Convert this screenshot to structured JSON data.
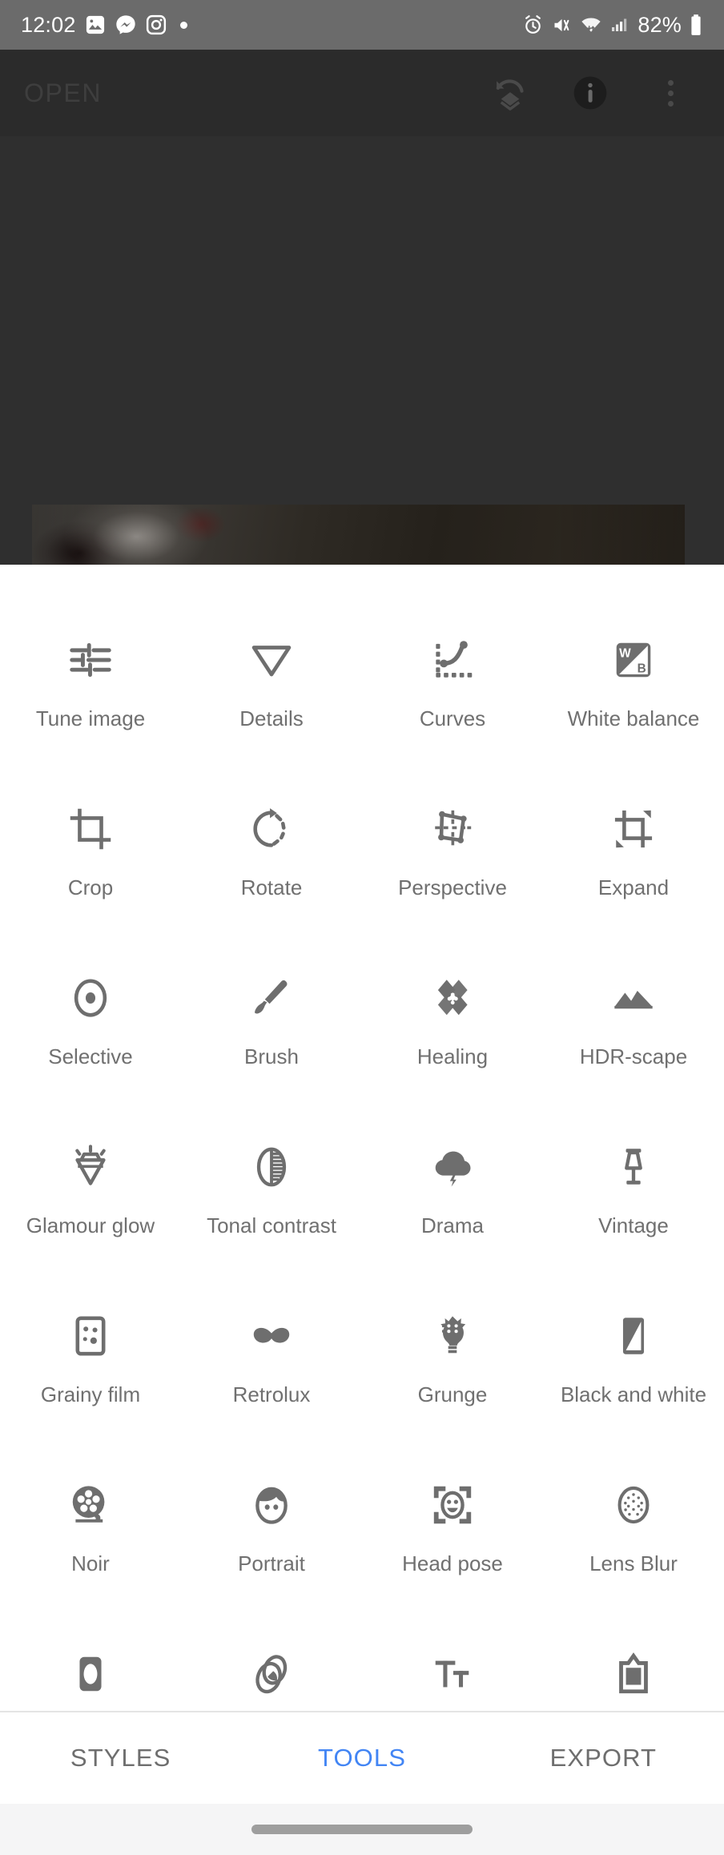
{
  "status_bar": {
    "time": "12:02",
    "battery_percent": "82%",
    "left_icons": [
      "photos-icon",
      "messenger-icon",
      "instagram-icon",
      "dot-indicator-icon"
    ],
    "right_icons": [
      "alarm-icon",
      "vibrate-mute-icon",
      "wifi-icon",
      "cellular-signal-icon",
      "battery-icon"
    ],
    "background_color": "#6b6b6b",
    "foreground_color": "#ffffff"
  },
  "app_bar": {
    "title": "OPEN",
    "background_color": "#2b2b2b",
    "actions": [
      {
        "name": "undo-stack-icon",
        "label": "Undo / Stacks"
      },
      {
        "name": "info-icon",
        "label": "Info"
      },
      {
        "name": "overflow-menu-icon",
        "label": "More options"
      }
    ]
  },
  "canvas": {
    "background_color": "#2f2f2f",
    "photo_description": "dark low-key photo of a rose and dark background"
  },
  "tools": {
    "rows": [
      [
        {
          "label": "Tune image",
          "icon": "sliders-icon"
        },
        {
          "label": "Details",
          "icon": "triangle-down-icon"
        },
        {
          "label": "Curves",
          "icon": "curves-icon"
        },
        {
          "label": "White balance",
          "icon": "white-balance-icon"
        }
      ],
      [
        {
          "label": "Crop",
          "icon": "crop-icon"
        },
        {
          "label": "Rotate",
          "icon": "rotate-icon"
        },
        {
          "label": "Perspective",
          "icon": "perspective-icon"
        },
        {
          "label": "Expand",
          "icon": "expand-icon"
        }
      ],
      [
        {
          "label": "Selective",
          "icon": "selective-icon"
        },
        {
          "label": "Brush",
          "icon": "brush-icon"
        },
        {
          "label": "Healing",
          "icon": "healing-icon"
        },
        {
          "label": "HDR-scape",
          "icon": "hdr-scape-icon"
        }
      ],
      [
        {
          "label": "Glamour glow",
          "icon": "glamour-glow-icon"
        },
        {
          "label": "Tonal contrast",
          "icon": "tonal-contrast-icon"
        },
        {
          "label": "Drama",
          "icon": "drama-cloud-icon"
        },
        {
          "label": "Vintage",
          "icon": "vintage-lamp-icon"
        }
      ],
      [
        {
          "label": "Grainy film",
          "icon": "grainy-film-icon"
        },
        {
          "label": "Retrolux",
          "icon": "retrolux-mustache-icon"
        },
        {
          "label": "Grunge",
          "icon": "grunge-guitar-icon"
        },
        {
          "label": "Black and white",
          "icon": "black-and-white-icon"
        }
      ],
      [
        {
          "label": "Noir",
          "icon": "noir-film-reel-icon"
        },
        {
          "label": "Portrait",
          "icon": "portrait-face-icon"
        },
        {
          "label": "Head pose",
          "icon": "head-pose-icon"
        },
        {
          "label": "Lens Blur",
          "icon": "lens-blur-icon"
        }
      ],
      [
        {
          "label": "",
          "icon": "vignette-icon"
        },
        {
          "label": "",
          "icon": "double-exposure-icon"
        },
        {
          "label": "",
          "icon": "text-icon"
        },
        {
          "label": "",
          "icon": "frames-icon"
        }
      ]
    ],
    "label_color": "#707070",
    "icon_color": "#6e6e6e"
  },
  "bottom_nav": {
    "items": [
      {
        "label": "STYLES",
        "active": false
      },
      {
        "label": "TOOLS",
        "active": true
      },
      {
        "label": "EXPORT",
        "active": false
      }
    ],
    "active_color": "#4285f4",
    "inactive_color": "#6e6e6e"
  }
}
